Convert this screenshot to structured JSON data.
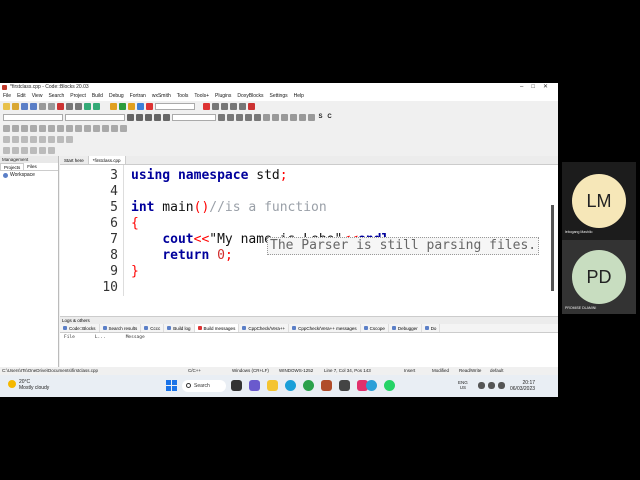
{
  "window": {
    "title": "*firstclass.cpp - Code::Blocks 20.03"
  },
  "menu": [
    "File",
    "Edit",
    "View",
    "Search",
    "Project",
    "Build",
    "Debug",
    "Fortran",
    "wxSmith",
    "Tools",
    "Tools+",
    "Plugins",
    "DoxyBlocks",
    "Settings",
    "Help"
  ],
  "management": {
    "header": "Management",
    "tabs": [
      "Projects",
      "Files"
    ],
    "workspace": "Workspace"
  },
  "editor": {
    "tabs": [
      "Start here",
      "*firstclass.cpp"
    ],
    "lines": [
      {
        "n": "3",
        "text": "using namespace std;"
      },
      {
        "n": "4",
        "text": ""
      },
      {
        "n": "5",
        "text": "int main()//is a function"
      },
      {
        "n": "6",
        "text": "{"
      },
      {
        "n": "7",
        "text": "    cout<<\"My name is Lebo\"<<endl"
      },
      {
        "n": "8",
        "text": "    return 0;"
      },
      {
        "n": "9",
        "text": "}"
      },
      {
        "n": "10",
        "text": ""
      }
    ],
    "tooltip": "The Parser is still parsing files."
  },
  "logs": {
    "header": "Logs & others",
    "tabs": [
      "Code::Blocks",
      "Search results",
      "Cccc",
      "Build log",
      "Build messages",
      "CppCheck/Vera++",
      "CppCheck/Vera++ messages",
      "Cscope",
      "Debugger",
      "Do"
    ],
    "columns": [
      "File",
      "L...",
      "Message"
    ]
  },
  "status": {
    "path": "C:\\Users\\ITs\\OneDrive\\Documents\\firstclass.cpp",
    "lang": "C/C++",
    "eol": "Windows (CR+LF)",
    "encoding": "WINDOWS-1252",
    "position": "Line 7, Col 34, Pos 143",
    "mode": "Insert",
    "modified": "Modified",
    "rw": "Read/Write",
    "profile": "default"
  },
  "taskbar": {
    "temp": "20°C",
    "weather": "Mostly cloudy",
    "search": "Search",
    "lang": "ENG",
    "region": "US",
    "time": "20:17",
    "date": "06/03/2023"
  },
  "participants": [
    {
      "initials": "LM",
      "name": "lebogang Mashilo",
      "color": "#f6e7b8"
    },
    {
      "initials": "PD",
      "name": "PROMISE DLAMINI",
      "color": "#c8ddc0"
    }
  ]
}
